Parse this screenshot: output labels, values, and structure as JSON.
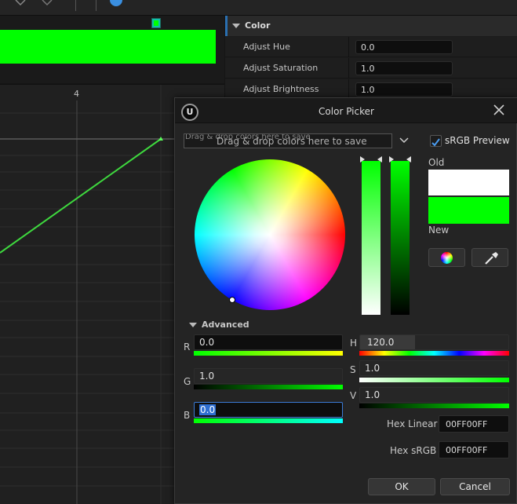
{
  "toolbar": {
    "icons": [
      "move-icon",
      "select-icon",
      "snap-icon",
      "info-icon"
    ]
  },
  "curve_editor": {
    "gradient_color": "#00ff00",
    "axis_label": "4"
  },
  "details": {
    "category": "Color",
    "properties": [
      {
        "name": "Adjust Hue",
        "value": "0.0"
      },
      {
        "name": "Adjust Saturation",
        "value": "1.0"
      },
      {
        "name": "Adjust Brightness",
        "value": "1.0"
      }
    ]
  },
  "picker": {
    "title": "Color Picker",
    "theme_bar_text": "Drag & drop colors here to save",
    "srgb_preview_label": "sRGB Preview",
    "srgb_preview_checked": true,
    "old_label": "Old",
    "new_label": "New",
    "old_color": "#ffffff",
    "new_color": "#00ff00",
    "advanced_label": "Advanced",
    "channels": {
      "r": {
        "label": "R",
        "value": "0.0"
      },
      "g": {
        "label": "G",
        "value": "1.0"
      },
      "b": {
        "label": "B",
        "value": "0.0"
      },
      "h": {
        "label": "H",
        "value": "120.0"
      },
      "s": {
        "label": "S",
        "value": "1.0"
      },
      "v": {
        "label": "V",
        "value": "1.0"
      }
    },
    "hex_linear_label": "Hex Linear",
    "hex_linear_value": "00FF00FF",
    "hex_srgb_label": "Hex sRGB",
    "hex_srgb_value": "00FF00FF",
    "ok_label": "OK",
    "cancel_label": "Cancel"
  }
}
